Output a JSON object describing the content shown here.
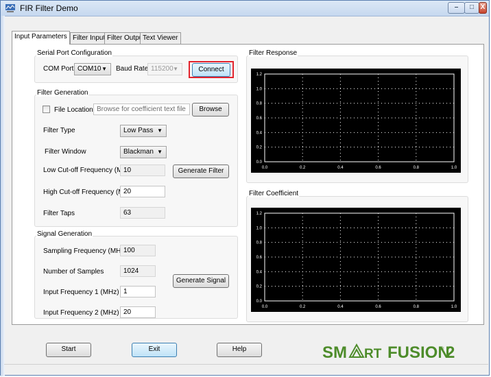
{
  "window": {
    "title": "FIR Filter Demo",
    "minimize_glyph": "–",
    "maximize_glyph": "□",
    "close_glyph": "X"
  },
  "tabs": [
    "Input Parameters",
    "Filter Input",
    "Filter Output",
    "Text Viewer"
  ],
  "active_tab": "Input Parameters",
  "serial_port": {
    "group_label": "Serial Port Configuration",
    "com_port_label": "COM Port",
    "com_port_value": "COM10",
    "baud_rate_label": "Baud Rate",
    "baud_rate_value": "115200",
    "connect_label": "Connect"
  },
  "filter_generation": {
    "group_label": "Filter Generation",
    "file_location_label": "File Location",
    "file_location_checked": false,
    "file_placeholder": "Browse for coefficient text file",
    "browse_label": "Browse",
    "filter_type_label": "Filter Type",
    "filter_type_value": "Low Pass",
    "filter_window_label": "Filter Window",
    "filter_window_value": "Blackman",
    "low_cutoff_label": "Low Cut-off Frequency (MHz)",
    "low_cutoff_value": "10",
    "generate_filter_label": "Generate Filter",
    "high_cutoff_label": "High Cut-off Frequency (MHz)",
    "high_cutoff_value": "20",
    "filter_taps_label": "Filter Taps",
    "filter_taps_value": "63"
  },
  "signal_generation": {
    "group_label": "Signal Generation",
    "sampling_label": "Sampling Frequency (MHz)",
    "sampling_value": "100",
    "samples_label": "Number of Samples",
    "samples_value": "1024",
    "input1_label": "Input Frequency 1 (MHz)",
    "input1_value": "1",
    "input2_label": "Input Frequency 2 (MHz)",
    "input2_value": "20",
    "generate_signal_label": "Generate Signal"
  },
  "charts": {
    "filter_response_label": "Filter Response",
    "filter_coefficient_label": "Filter Coefficient"
  },
  "chart_data": [
    {
      "type": "line",
      "title": "",
      "xlabel": "",
      "ylabel": "",
      "xlim": [
        0.0,
        1.0
      ],
      "ylim": [
        0.0,
        1.2
      ],
      "x_ticks": [
        "0.0",
        "0.2",
        "0.4",
        "0.6",
        "0.8",
        "1.0"
      ],
      "y_ticks": [
        "0.0",
        "0.2",
        "0.4",
        "0.6",
        "0.8",
        "1.0",
        "1.2"
      ],
      "grid": true,
      "series": []
    },
    {
      "type": "line",
      "title": "",
      "xlabel": "",
      "ylabel": "",
      "xlim": [
        0.0,
        1.0
      ],
      "ylim": [
        0.0,
        1.2
      ],
      "x_ticks": [
        "0.0",
        "0.2",
        "0.4",
        "0.6",
        "0.8",
        "1.0"
      ],
      "y_ticks": [
        "0.0",
        "0.2",
        "0.4",
        "0.6",
        "0.8",
        "1.0",
        "1.2"
      ],
      "grid": true,
      "series": []
    }
  ],
  "bottom": {
    "start_label": "Start",
    "exit_label": "Exit",
    "help_label": "Help"
  },
  "logo": {
    "part1": "SM",
    "part2": "RT",
    "part3": "FUSION",
    "mark": "®",
    "part4": "2",
    "color": "#4d8c2a"
  },
  "colors": {
    "highlight": "#e3232c",
    "plot_bg": "#000000"
  }
}
